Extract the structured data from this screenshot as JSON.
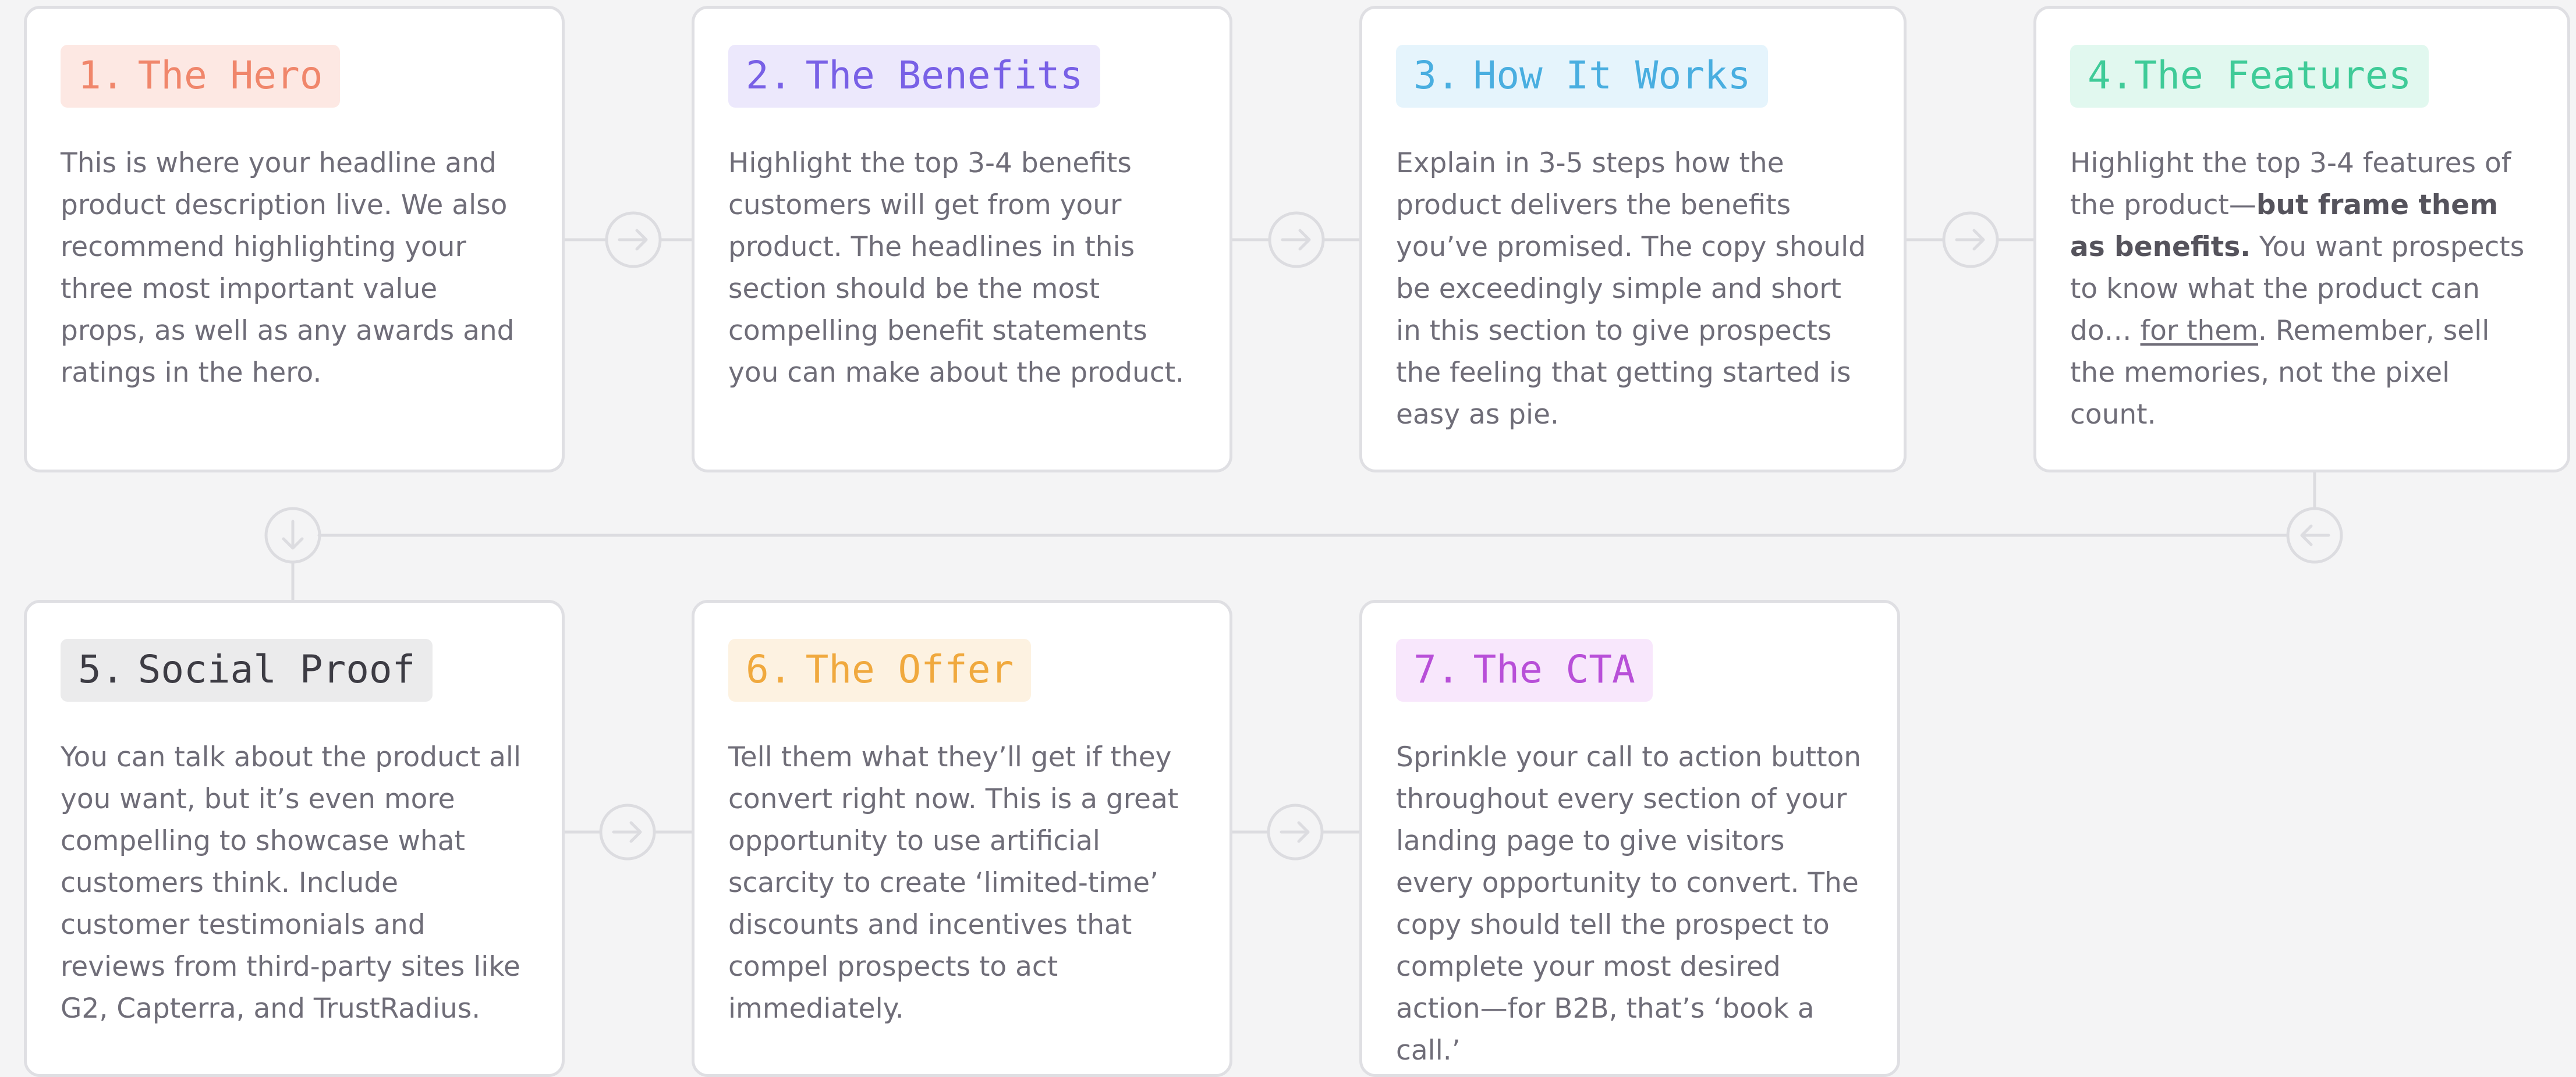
{
  "steps": [
    {
      "num": "1.",
      "title": "The Hero",
      "color": "#f0866b",
      "bg": "#fde8e3",
      "text": "This is where your headline and product description live. We also recommend highlighting your three most important value props, as well as any awards and ratings in the hero."
    },
    {
      "num": "2.",
      "title": "The Benefits",
      "color": "#7860e6",
      "bg": "#ece8fc",
      "text": "Highlight the top 3-4 benefits customers will get from your product. The headlines in this section should be the most compelling benefit statements you can make about the product."
    },
    {
      "num": "3.",
      "title": "How It Works",
      "color": "#49aee0",
      "bg": "#e5f4fc",
      "text": "Explain in 3-5 steps how the product delivers the benefits you’ve promised. The copy should be exceedingly simple and short in this section to give prospects the feeling that getting started is easy as pie."
    },
    {
      "num": "4.",
      "title": "The Features",
      "color": "#3fcb98",
      "bg": "#e1f8ef",
      "text_a": "Highlight the top 3-4 features of the product—",
      "text_bold": "but frame them as benefits.",
      "text_b": " You want prospects to know what the product can do… ",
      "text_link": "for them",
      "text_c": ". Remember, sell the memories, not the pixel count."
    },
    {
      "num": "5.",
      "title": "Social Proof",
      "color": "#3d3c44",
      "bg": "#ebebec",
      "text": "You can talk about the product all you want, but it’s even more compelling to showcase what customers think. Include customer testimonials and reviews from third-party sites like G2, Capterra, and TrustRadius."
    },
    {
      "num": "6.",
      "title": "The Offer",
      "color": "#f0a93e",
      "bg": "#fdf2e1",
      "text": "Tell them what they’ll get if they convert right now. This is a great opportunity to use artificial scarcity to create ‘limited-time’ discounts and incentives that compel prospects to act immediately."
    },
    {
      "num": "7.",
      "title": "The CTA",
      "color": "#b84fd8",
      "bg": "#f8e7fc",
      "text": "Sprinkle your call to action button throughout every section of your landing page to give visitors every opportunity to convert. The copy should tell the prospect to complete your most desired action—for B2B, that’s ‘book a call.’"
    }
  ],
  "connectors": {
    "line_color": "#dcdce0",
    "arrows": [
      "arrow-right-icon",
      "arrow-right-icon",
      "arrow-right-icon",
      "arrow-left-icon",
      "arrow-down-icon",
      "arrow-right-icon",
      "arrow-right-icon"
    ]
  }
}
